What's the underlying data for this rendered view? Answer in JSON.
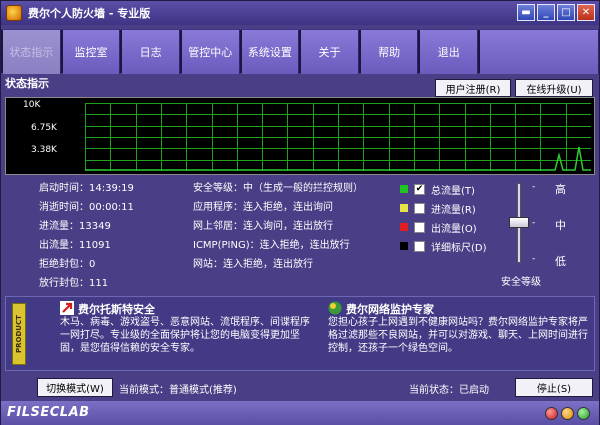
{
  "window": {
    "title": "费尔个人防火墙 - 专业版"
  },
  "tabs": [
    "状态指示",
    "监控室",
    "日志",
    "管控中心",
    "系统设置",
    "关于",
    "帮助",
    "退出"
  ],
  "status": {
    "section_title": "状态指示",
    "register_button": "用户注册(R)",
    "upgrade_button": "在线升级(U)"
  },
  "graph": {
    "labels": {
      "top": "10K",
      "mid": "6.75K",
      "low": "3.38K"
    },
    "grid_color": "#1fa01f",
    "line_color": "#2ecc2e"
  },
  "info_left": [
    "启动时间：14:39:19",
    "消逝时间：00:00:11",
    "进流量：13349",
    "出流量：11091",
    "拒绝封包：0",
    "放行封包：111"
  ],
  "info_mid": [
    "安全等级：中（生成一般的拦控规则）",
    "应用程序：连入拒绝，连出询问",
    "网上邻居：连入询问，连出放行",
    "ICMP(PING)：连入拒绝，连出放行",
    "网站：连入拒绝，连出放行"
  ],
  "legend": [
    {
      "label": "总流量(T)",
      "color": "#22c422",
      "checked": true
    },
    {
      "label": "进流量(R)",
      "color": "#e8e24a",
      "checked": false
    },
    {
      "label": "出流量(O)",
      "color": "#e02020",
      "checked": false
    },
    {
      "label": "详细标尺(D)",
      "color": "#000000",
      "checked": false
    }
  ],
  "security_level": {
    "high": "高",
    "mid": "中",
    "low": "低",
    "caption": "安全等级",
    "dash": "-",
    "selected": "中"
  },
  "ad_left": {
    "badge": "PRODUCT",
    "title": "费尔托斯特安全",
    "text": "木马、病毒、游戏盗号、恶意网站、流氓程序、间谍程序一网打尽。专业级的全面保护将让您的电脑变得更加坚固，是您值得信赖的安全专家。"
  },
  "ad_right": {
    "title": "费尔网络监护专家",
    "text": "您担心孩子上网遇到不健康网站吗？费尔网络监护专家将严格过滤那些不良网站，并可以对游戏、聊天、上网时间进行控制，还孩子一个绿色空间。"
  },
  "bottom": {
    "switch_mode_button": "切换模式(W)",
    "current_mode": "当前模式：普通模式(推荐)",
    "current_state": "当前状态：已启动",
    "stop_button": "停止(S)"
  },
  "footer": {
    "brand": "FILSECLAB"
  }
}
